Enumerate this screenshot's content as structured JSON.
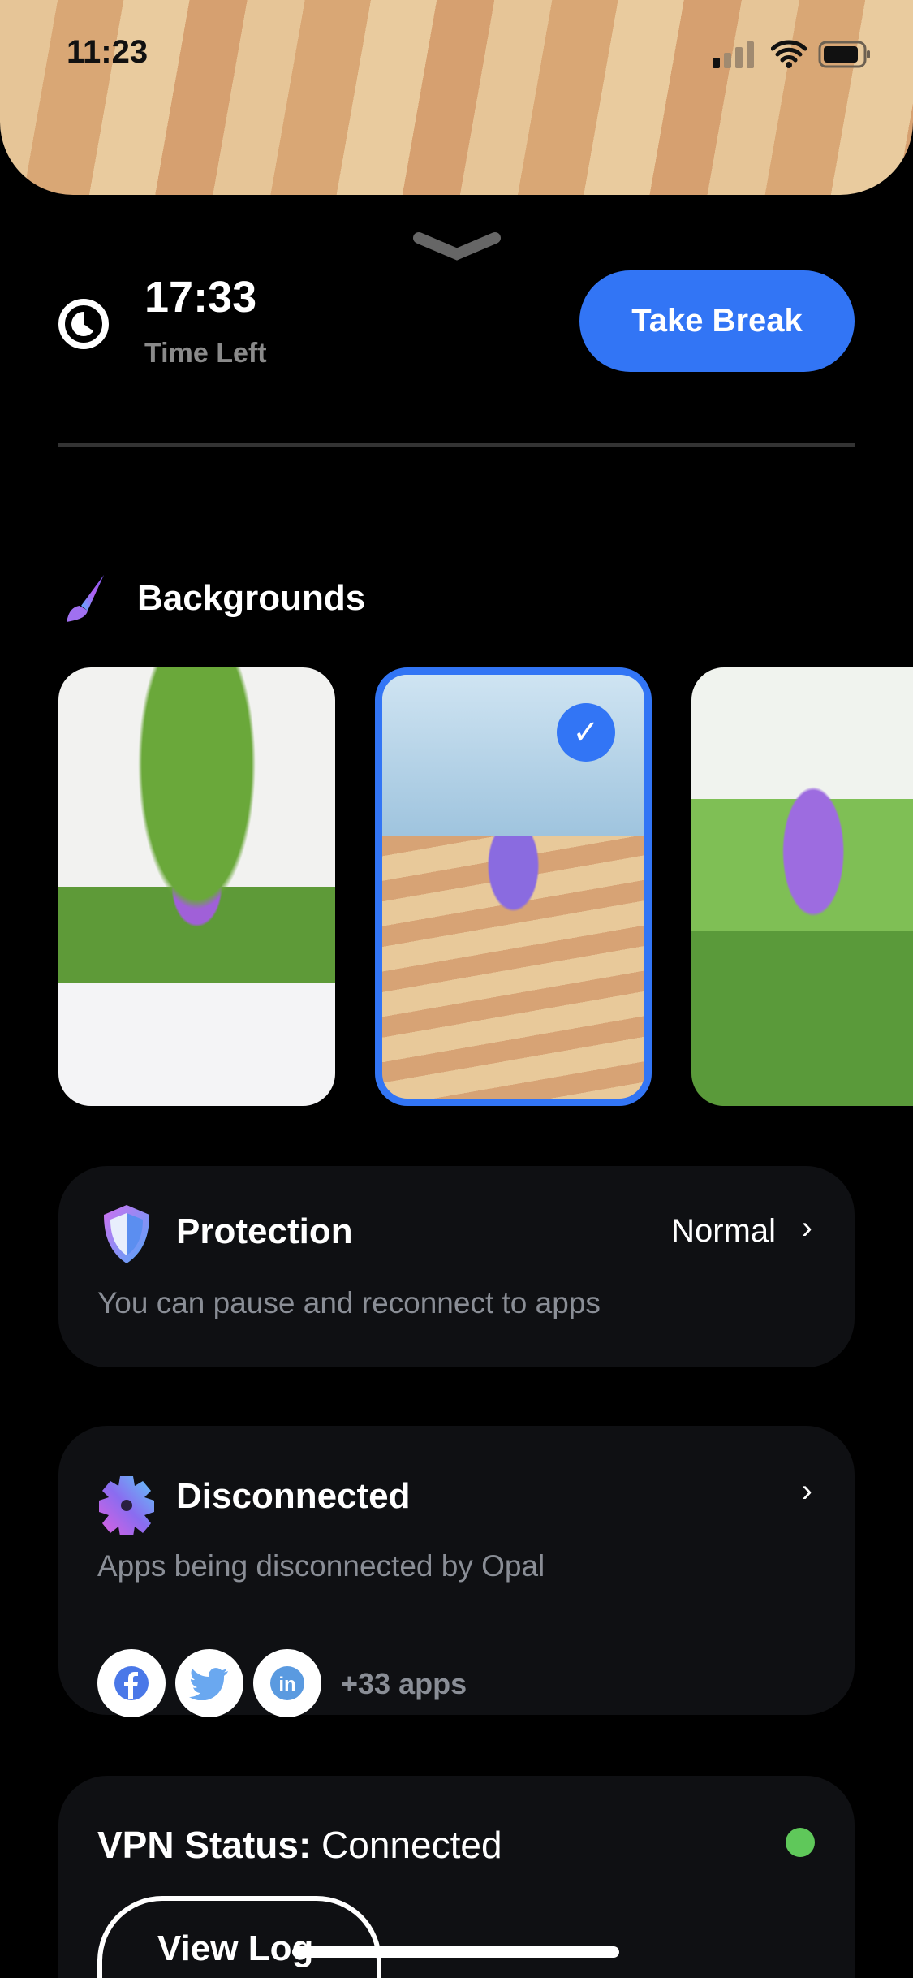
{
  "status_bar": {
    "time": "11:23"
  },
  "timer": {
    "value": "17:33",
    "label": "Time Left",
    "button": "Take Break"
  },
  "backgrounds": {
    "title": "Backgrounds",
    "selected_index": 1,
    "count_visible": 3
  },
  "protection": {
    "title": "Protection",
    "value": "Normal",
    "subtitle": "You can pause and reconnect to apps"
  },
  "disconnected": {
    "title": "Disconnected",
    "subtitle": "Apps being disconnected by Opal",
    "apps": [
      "facebook",
      "twitter",
      "linkedin"
    ],
    "more": "+33 apps"
  },
  "vpn": {
    "label": "VPN Status:",
    "value": "Connected",
    "status_color": "#5fc85a",
    "button": "View Log"
  },
  "colors": {
    "accent": "#3275f5",
    "card": "#0f1013"
  }
}
